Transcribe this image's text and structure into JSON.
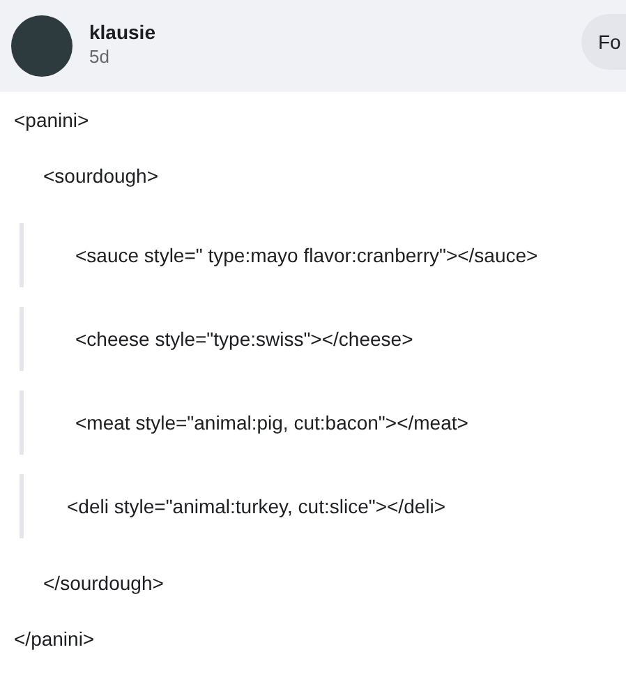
{
  "post_header": {
    "username": "klausie",
    "time": "5d",
    "follow_button": "Fo"
  },
  "lines": [
    {
      "kind": "outer",
      "text": "<panini>"
    },
    {
      "kind": "inner",
      "text": "<sourdough>"
    },
    {
      "kind": "quote",
      "text": "<sauce style=\" type:mayo flavor:cranberry\"></sauce>"
    },
    {
      "kind": "quote",
      "text": "<cheese style=\"type:swiss\"></cheese>"
    },
    {
      "kind": "quote",
      "text": "<meat style=\"animal:pig, cut:bacon\"></meat>"
    },
    {
      "kind": "quote-tight",
      "text": "<deli style=\"animal:turkey, cut:slice\"></deli>"
    },
    {
      "kind": "inner",
      "text": "</sourdough>"
    },
    {
      "kind": "outer",
      "text": "</panini>"
    }
  ]
}
